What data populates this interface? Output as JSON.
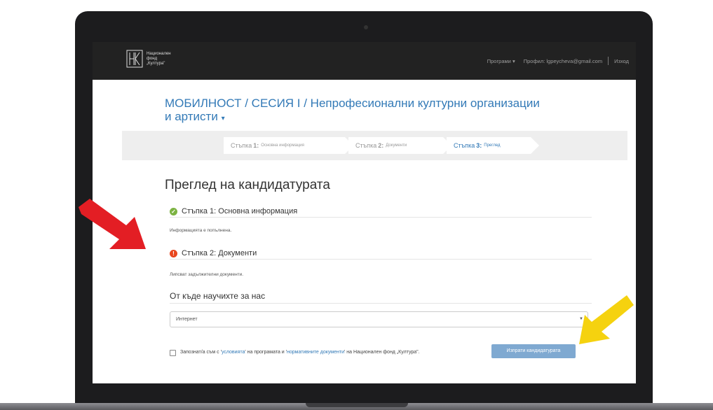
{
  "nav": {
    "logo_lines": [
      "Национален",
      "фонд",
      "„Култура\""
    ],
    "programs": "Програми ▾",
    "profile": "Профил: lgpeycheva@gmail.com",
    "logout": "Изход"
  },
  "page": {
    "title_line1": "МОБИЛНОСТ / СЕСИЯ I / Непрофесионални културни организации",
    "title_line2": "и артисти",
    "title_caret": "▾"
  },
  "steps": [
    {
      "label": "Стъпка",
      "num": "1:",
      "desc": "Основна информация"
    },
    {
      "label": "Стъпка",
      "num": "2:",
      "desc": "Документи"
    },
    {
      "label": "Стъпка",
      "num": "3:",
      "desc": "Преглед"
    }
  ],
  "review": {
    "heading": "Преглед на кандидатурата",
    "section1": {
      "title": "Стъпка 1: Основна информация",
      "note": "Информацията е попълнена.",
      "status_icon": "check-icon",
      "color": "#5cb85c"
    },
    "section2": {
      "title": "Стъпка 2: Документи",
      "note": "Липсват задължителни документи.",
      "status_icon": "exclamation-icon",
      "color": "#e74c3c"
    },
    "where_heading": "От къде научихте за нас",
    "select_value": "Интернет",
    "agree_pre": "Запознат/а съм с '",
    "agree_link1": "условията",
    "agree_mid": "' на програмата и '",
    "agree_link2": "нормативните документи",
    "agree_post": "' на Национален фонд „Култура\".",
    "submit": "Изпрати кандидатурата"
  },
  "colors": {
    "link": "#337ab7",
    "navbar": "#222222",
    "arrow_red": "#e31e24",
    "arrow_yellow": "#f5d20f"
  }
}
